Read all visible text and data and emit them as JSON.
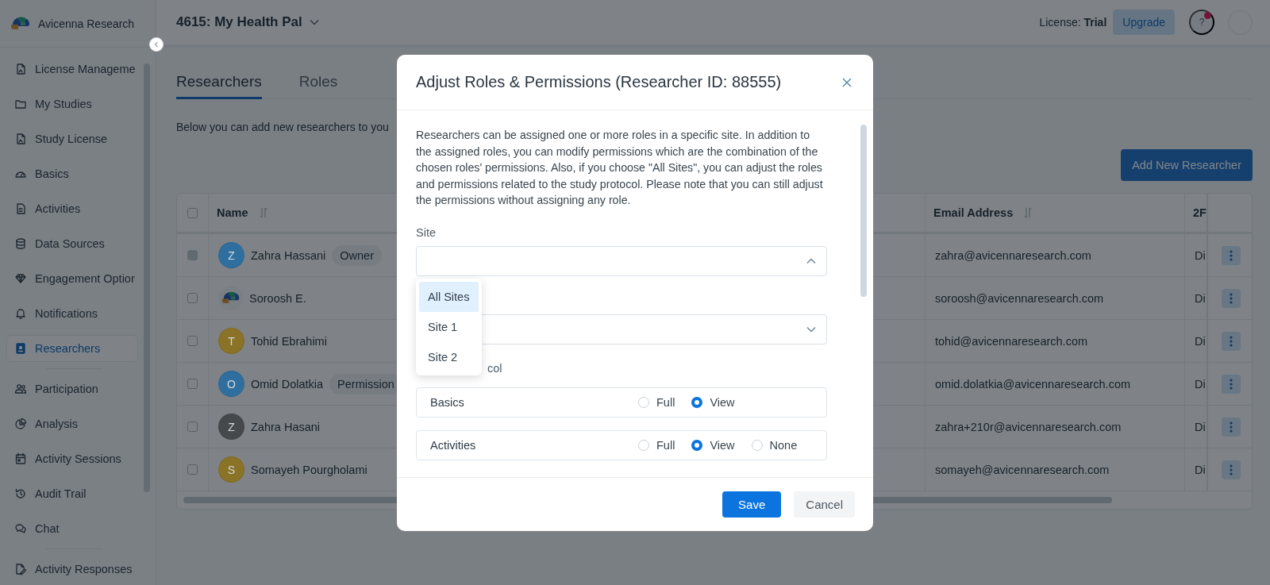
{
  "sidebar": {
    "brand": "Avicenna Research",
    "items": [
      {
        "label": "License Manageme",
        "selected": false
      },
      {
        "label": "My Studies",
        "selected": false
      },
      {
        "label": "Study License",
        "selected": false
      },
      {
        "label": "Basics",
        "selected": false
      },
      {
        "label": "Activities",
        "selected": false
      },
      {
        "label": "Data Sources",
        "selected": false
      },
      {
        "label": "Engagement Optior",
        "selected": false
      },
      {
        "label": "Notifications",
        "selected": false
      },
      {
        "label": "Researchers",
        "selected": true
      },
      {
        "label": "Participation",
        "selected": false
      },
      {
        "label": "Analysis",
        "selected": false
      },
      {
        "label": "Activity Sessions",
        "selected": false
      },
      {
        "label": "Audit Trail",
        "selected": false
      },
      {
        "label": "Chat",
        "selected": false
      },
      {
        "label": "Activity Responses",
        "selected": false
      }
    ]
  },
  "header": {
    "project": "4615: My Health Pal",
    "license": "License: **Trial**",
    "upgrade": "Upgrade",
    "help": "?",
    "notification_dot": true
  },
  "tabs": [
    {
      "label": "Researchers",
      "selected": true
    },
    {
      "label": "Roles",
      "selected": false
    }
  ],
  "intro": "Below you can add new researchers to you",
  "add_button": "Add New Researcher",
  "table": {
    "columns": [
      "Name",
      "Email Address",
      "2F"
    ],
    "header_checked": false,
    "rows": [
      {
        "avatar": {
          "kind": "initial",
          "initial": "Z",
          "color": "#2f6f9f"
        },
        "name": "Zahra Hassani",
        "badge": "Owner",
        "email": "zahra@avicennaresearch.com",
        "column_3": "Di",
        "checked": false,
        "disabled": true
      },
      {
        "avatar": {
          "kind": "logo"
        },
        "name": "Soroosh E.",
        "email": "soroosh@avicennaresearch.com",
        "column_3": "Di",
        "checked": false,
        "disabled": false
      },
      {
        "avatar": {
          "kind": "initial",
          "initial": "T",
          "color": "#8a7326"
        },
        "name": "Tohid Ebrahimi",
        "email": "tohid@avicennaresearch.com",
        "column_3": "Di",
        "checked": false,
        "disabled": false
      },
      {
        "avatar": {
          "kind": "initial",
          "initial": "O",
          "color": "#2f6f9f"
        },
        "name": "Omid Dolatkia",
        "badge": "Permission",
        "email": "omid.dolatkia@avicennaresearch.com",
        "column_3": "Di",
        "checked": false,
        "disabled": false
      },
      {
        "avatar": {
          "kind": "initial",
          "initial": "Z",
          "color": "#45494c"
        },
        "name": "Zahra Hasani",
        "email": "zahra+210r@avicennaresearch.com",
        "column_3": "Di",
        "checked": false,
        "disabled": false
      },
      {
        "avatar": {
          "kind": "initial",
          "initial": "S",
          "color": "#8a7326"
        },
        "name": "Somayeh Pourgholami",
        "email": "somayeh@avicennaresearch.com",
        "column_3": "Di",
        "checked": false,
        "disabled": false
      }
    ]
  },
  "modal": {
    "title": "Adjust Roles & Permissions (Researcher ID: 88555)",
    "description": "Researchers can be assigned one or more roles in a specific site. In addition to the assigned roles, you can modify permissions which are the combination of the chosen roles' permissions. Also, if you choose \"All Sites\", you can adjust the roles and permissions related to the study protocol. Please note that you can still adjust the permissions without assigning any role.",
    "site_label": "Site",
    "site_select": {
      "expanded": true,
      "options": [
        {
          "label": "All Sites",
          "selected": true
        },
        {
          "label": "Site 1",
          "selected": false
        },
        {
          "label": "Site 2",
          "selected": false
        }
      ]
    },
    "select_2": {
      "expanded": false
    },
    "protocol_label": "col",
    "permissions": [
      {
        "label": "Basics",
        "options": [
          {
            "label": "Full",
            "selected": false
          },
          {
            "label": "View",
            "selected": true
          }
        ]
      },
      {
        "label": "Activities",
        "options": [
          {
            "label": "Full",
            "selected": false
          },
          {
            "label": "View",
            "selected": true
          },
          {
            "label": "None",
            "selected": false
          }
        ]
      }
    ],
    "save": "Save",
    "cancel": "Cancel"
  }
}
